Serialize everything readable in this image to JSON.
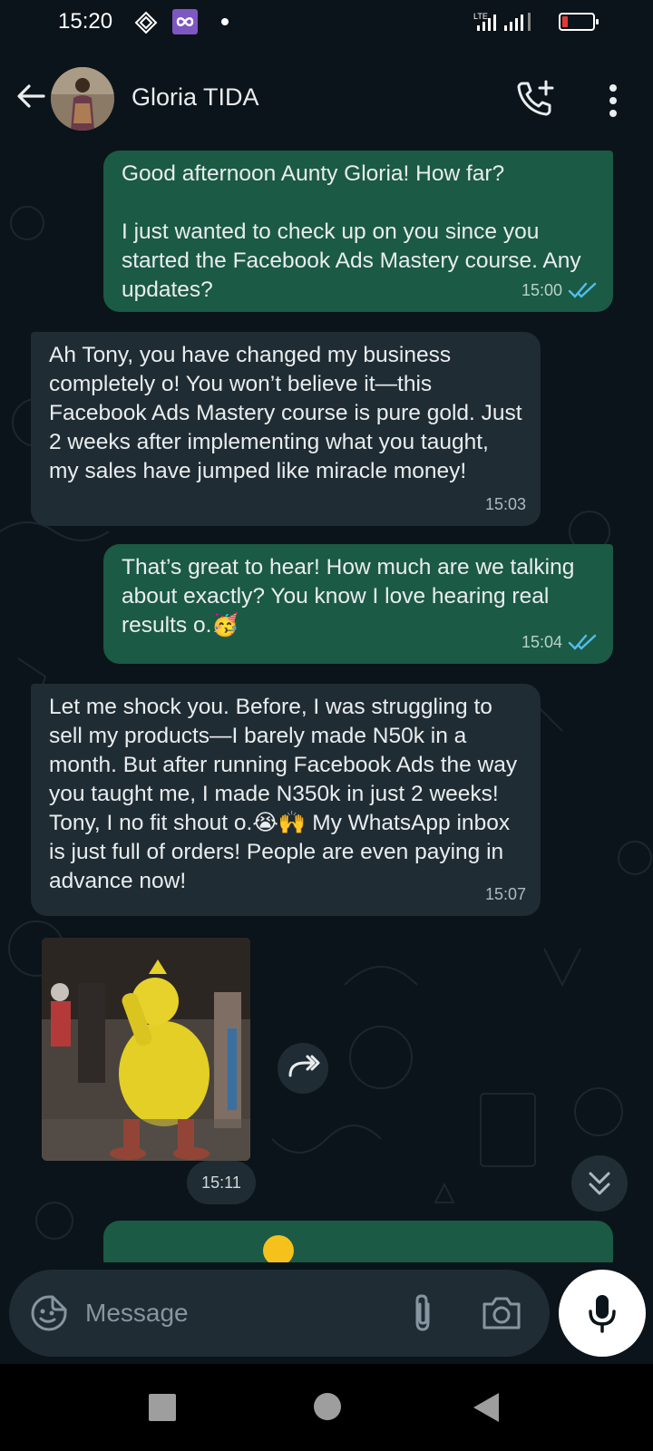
{
  "status_bar": {
    "time": "15:20",
    "network": "LTE"
  },
  "header": {
    "contact_name": "Gloria TIDA"
  },
  "messages": [
    {
      "direction": "outgoing",
      "text": "Good afternoon Aunty Gloria! How far?\n\nI just wanted to check up on you since you started the Facebook Ads Mastery course. Any updates?",
      "time": "15:00",
      "status": "read"
    },
    {
      "direction": "incoming",
      "text": "Ah Tony, you have changed my business completely o! You won’t believe it—this Facebook Ads Mastery course is pure gold. Just 2 weeks after implementing what you taught, my sales have jumped like miracle money!",
      "time": "15:03"
    },
    {
      "direction": "outgoing",
      "text": "That’s great to hear! How much are we talking about exactly? You know I love hearing real results o.🥳",
      "time": "15:04",
      "status": "read"
    },
    {
      "direction": "incoming",
      "text": "Let me shock you. Before, I was struggling to sell my products—I barely made N50k in a month. But after running Facebook Ads the way you taught me, I made N350k in just 2 weeks! Tony, I no fit shout o.😭🙌 My WhatsApp inbox is just full of orders! People are even paying in advance now!",
      "time": "15:07"
    },
    {
      "direction": "incoming",
      "type": "image",
      "time": "15:11"
    }
  ],
  "input": {
    "placeholder": "Message"
  },
  "colors": {
    "background": "#0b141a",
    "outgoing_bubble": "#1b5a44",
    "incoming_bubble": "#202c33",
    "read_tick": "#53bdeb"
  }
}
